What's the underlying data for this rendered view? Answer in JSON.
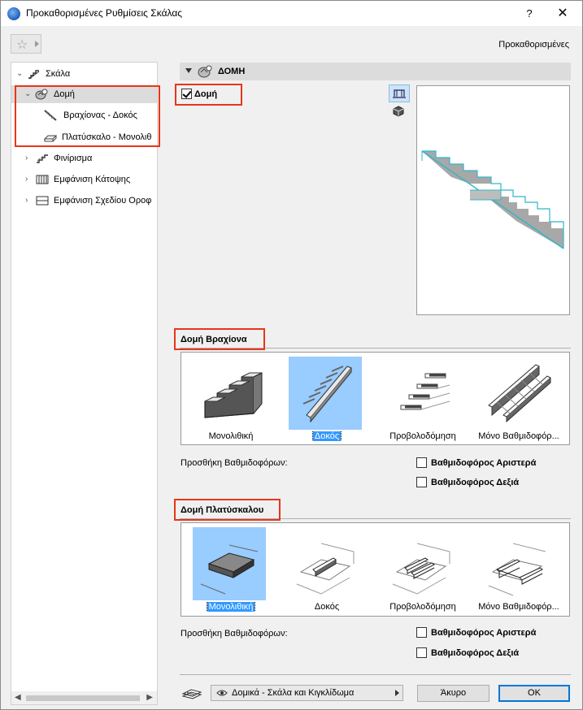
{
  "window": {
    "title": "Προκαθορισμένες Ρυθμίσεις Σκάλας",
    "help_label": "?",
    "close_label": "✕"
  },
  "toolbar": {
    "favorites_icon": "star-icon",
    "preset_label": "Προκαθορισμένες"
  },
  "tree": {
    "items": [
      {
        "label": "Σκάλα",
        "icon": "stair-icon",
        "chevron": "⌄"
      },
      {
        "label": "Δομή",
        "icon": "structure-icon",
        "chevron": "⌄"
      },
      {
        "label": "Βραχίονας - Δοκός",
        "icon": "flight-beam-icon"
      },
      {
        "label": "Πλατύσκαλο - Μονολιθ",
        "icon": "landing-icon"
      },
      {
        "label": "Φινίρισμα",
        "icon": "finish-icon",
        "chevron": "›"
      },
      {
        "label": "Εμφάνιση Κάτοψης",
        "icon": "floor-plan-icon",
        "chevron": "›"
      },
      {
        "label": "Εμφάνιση Σχεδίου Οροφ",
        "icon": "ceiling-plan-icon",
        "chevron": "›"
      }
    ]
  },
  "section": {
    "title": "ΔΟΜΗ",
    "structure_checkbox_label": "Δομή",
    "structure_checked": true
  },
  "flight": {
    "title": "Δομή Βραχίονα",
    "types": [
      {
        "label": "Μονολιθική",
        "selected": false
      },
      {
        "label": "Δοκός",
        "selected": true
      },
      {
        "label": "Προβολοδόμηση",
        "selected": false
      },
      {
        "label": "Μόνο Βαθμιδοφόρ...",
        "selected": false
      }
    ],
    "add_stringers_label": "Προσθήκη Βαθμιδοφόρων:",
    "stringer_left_label": "Βαθμιδοφόρος Αριστερά",
    "stringer_right_label": "Βαθμιδοφόρος Δεξιά"
  },
  "landing": {
    "title": "Δομή Πλατύσκαλου",
    "types": [
      {
        "label": "Μονολιθική",
        "selected": true
      },
      {
        "label": "Δοκός",
        "selected": false
      },
      {
        "label": "Προβολοδόμηση",
        "selected": false
      },
      {
        "label": "Μόνο Βαθμιδοφόρ...",
        "selected": false
      }
    ],
    "add_stringers_label": "Προσθήκη Βαθμιδοφόρων:",
    "stringer_left_label": "Βαθμιδοφόρος Αριστερά",
    "stringer_right_label": "Βαθμιδοφόρος Δεξιά"
  },
  "footer": {
    "layer_value": "Δομικά - Σκάλα και Κιγκλίδωμα",
    "cancel_label": "Άκυρο",
    "ok_label": "OK"
  },
  "colors": {
    "highlight": "#e8361a",
    "selection": "#99ccff",
    "stair_fill": "#a8a8a8",
    "stair_edge": "#2fb8c8"
  }
}
